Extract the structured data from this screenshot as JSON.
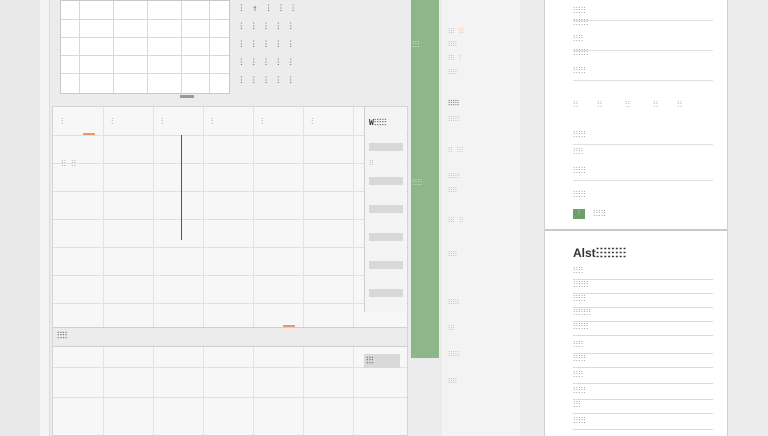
{
  "top_panel": {
    "dot_rows": [
      "ⵗ ↑ ⵗ ⵗ ⵗ",
      "ⵗ ⵗ ⵗ ⵗ ⵗ",
      "ⵗ ⵗ ⵗ ⵗ ⵗ",
      "ⵗ ⵗ ⵗ ⵗ ⵗ",
      "ⵗ ⵗ ⵗ ⵗ ⵗ"
    ]
  },
  "sheet": {
    "header_cells": [
      "ⵗ",
      "ⵗ",
      "ⵗ",
      "ⵗ",
      "ⵗ",
      "ⵗ",
      "ⵗ",
      "ⵗ"
    ],
    "row_label": "ⵗⵗ ⵗⵗ",
    "subhead": "ⵗⵗⵗⵗ",
    "side_title": "Wⵗⵗⵗⵗⵗ",
    "side_value": "ⵗⵗ",
    "bottom_badge": "ⵗⵗⵗ"
  },
  "green_bar": {
    "labels": [
      "ⵗⵗⵗ",
      "ⵗⵗⵗⵗ"
    ]
  },
  "middle_list": {
    "items": [
      {
        "text": "ⵗⵗⵗ",
        "hi": "ⵗⵗ"
      },
      {
        "text": "ⵗⵗⵗⵗ",
        "hi": ""
      },
      {
        "text": "ⵗⵗⵗ",
        "hi": "ⵗ"
      },
      {
        "text": "ⵗⵗⵗⵗ",
        "hi": ""
      },
      {
        "text": "ⵗⵗⵗⵗⵗ",
        "hi": ""
      },
      {
        "text": "ⵗⵗ",
        "hi": "ⵗⵗⵗ"
      },
      {
        "text": "ⵗⵗⵗⵗⵗ",
        "hi": ""
      },
      {
        "text": "ⵗⵗⵗⵗ",
        "hi": ""
      },
      {
        "text": "ⵗⵗⵗ",
        "hi": "ⵗⵗ"
      },
      {
        "text": "ⵗⵗⵗⵗ",
        "hi": ""
      },
      {
        "text": "ⵗⵗⵗⵗⵗ",
        "hi": ""
      },
      {
        "text": "ⵗⵗⵗ",
        "hi": ""
      },
      {
        "text": "ⵗⵗⵗⵗⵗ",
        "hi": ""
      },
      {
        "text": "ⵗⵗⵗⵗ",
        "hi": ""
      }
    ],
    "bold_label": "ⵗⵗⵗⵗⵗ"
  },
  "right_panel": {
    "top_items": [
      "ⵗⵗⵗⵗⵗ",
      "ⵗⵗⵗⵗⵗⵗ",
      "ⵗⵗⵗⵗ",
      "ⵗⵗⵗⵗⵗⵗ",
      "ⵗⵗⵗⵗⵗ"
    ],
    "num_row": [
      "ⵗⵗ",
      "ⵗⵗ",
      "ⵗⵗ",
      "ⵗⵗ",
      "ⵗⵗ"
    ],
    "mid_items": [
      "ⵗⵗⵗⵗⵗ",
      "ⵗⵗⵗⵗ",
      "ⵗⵗⵗⵗⵗ",
      "ⵗⵗⵗⵗⵗ"
    ],
    "tag_label": "ⵗ",
    "tag_text": "ⵗⵗⵗⵗⵗ",
    "heading": "Alstⵗⵗⵗⵗⵗⵗⵗⵗ",
    "fields": [
      "ⵗⵗⵗⵗ",
      "ⵗⵗⵗⵗⵗⵗ",
      "ⵗⵗⵗⵗⵗ",
      "ⵗⵗⵗⵗⵗⵗⵗ",
      "ⵗⵗⵗⵗⵗⵗ",
      "ⵗⵗⵗⵗ",
      "ⵗⵗⵗⵗⵗ",
      "ⵗⵗⵗⵗ",
      "ⵗⵗⵗⵗⵗ",
      "ⵗⵗⵗ",
      "ⵗⵗⵗⵗⵗ"
    ]
  }
}
